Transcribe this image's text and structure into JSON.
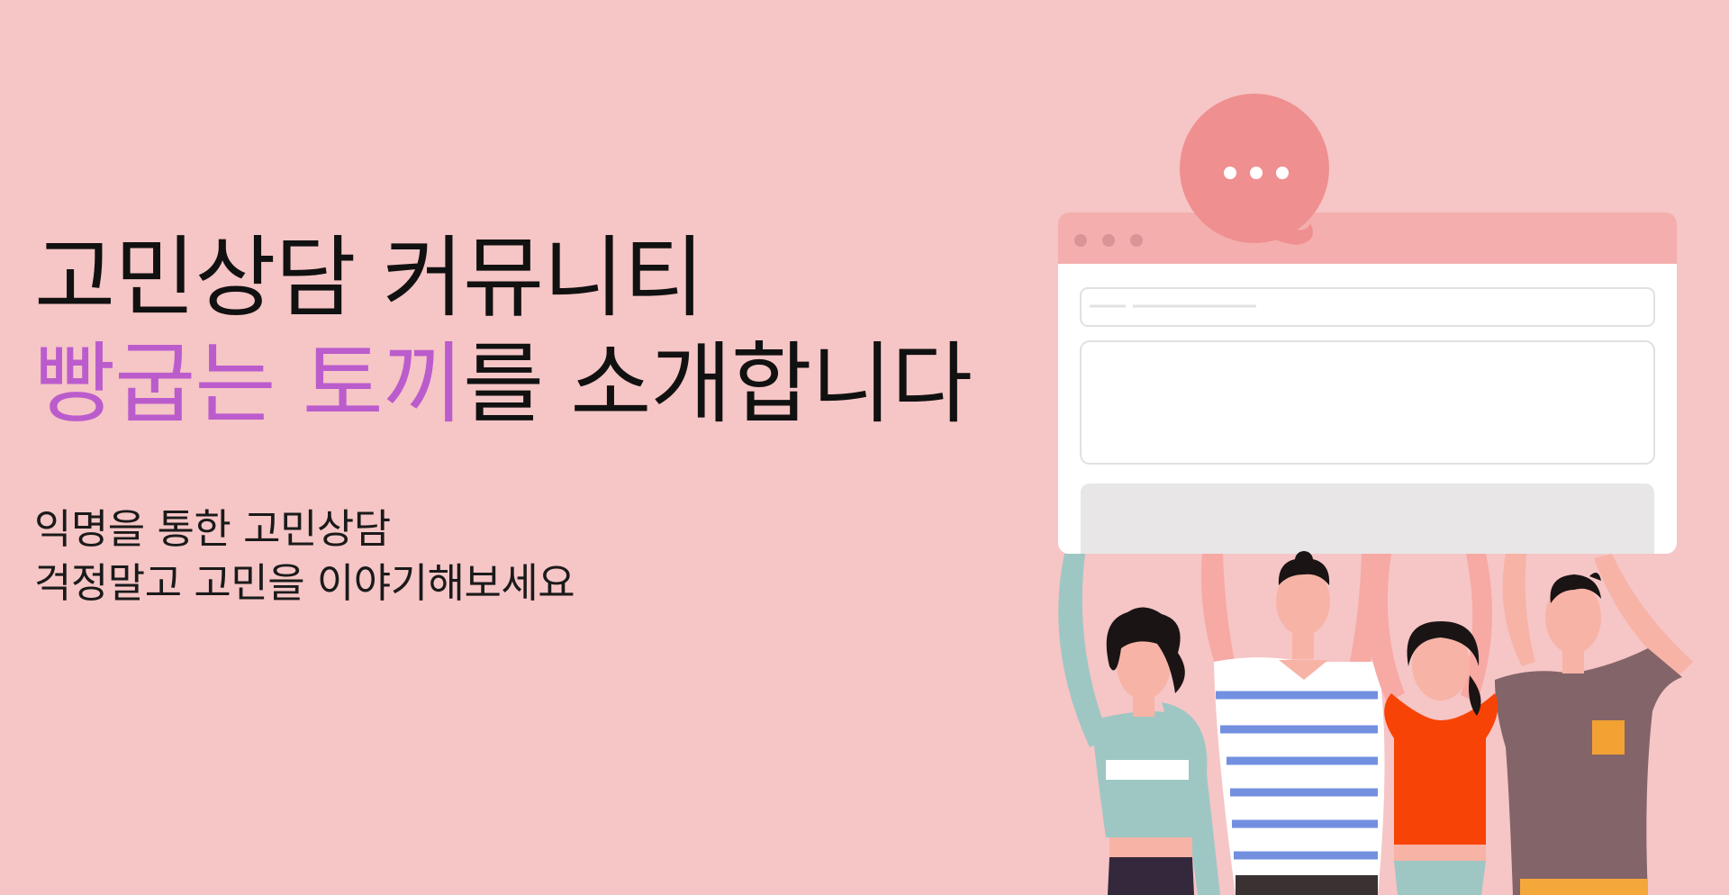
{
  "headline": {
    "line1": "고민상담 커뮤니티",
    "line2_accent": "빵굽는 토끼",
    "line2_rest": "를 소개합니다"
  },
  "subtext": {
    "line1": "익명을 통한 고민상담",
    "line2": "걱정말고 고민을 이야기해보세요"
  },
  "colors": {
    "background": "#f6c5c6",
    "accent": "#bb5ccd",
    "speech_bubble": "#ef8f90",
    "window_titlebar": "#f4aeae"
  },
  "icons": [
    "speech-bubble-icon",
    "window-dots-icon"
  ]
}
